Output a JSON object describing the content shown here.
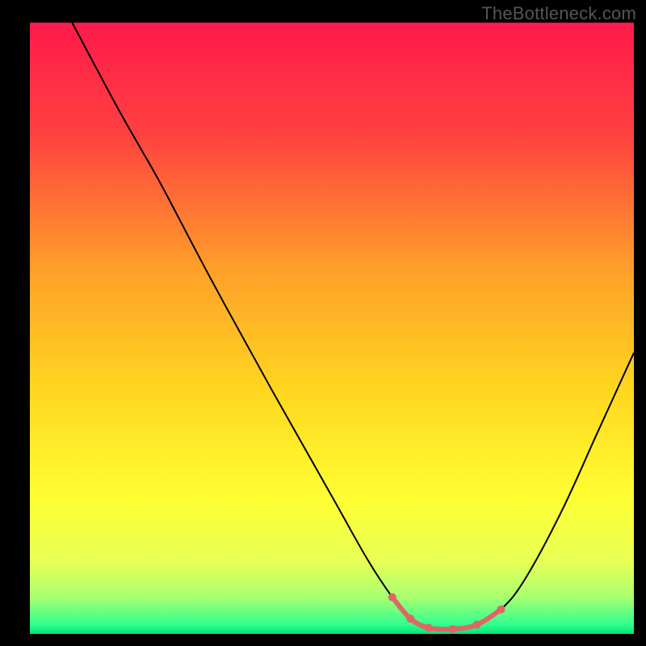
{
  "watermark": "TheBottleneck.com",
  "chart_data": {
    "type": "line",
    "title": "",
    "xlabel": "",
    "ylabel": "",
    "xlim": [
      0,
      100
    ],
    "ylim": [
      0,
      100
    ],
    "background_gradient": {
      "stops": [
        {
          "offset": 0.0,
          "color": "#ff1a4b"
        },
        {
          "offset": 0.18,
          "color": "#ff4040"
        },
        {
          "offset": 0.4,
          "color": "#ff9e2a"
        },
        {
          "offset": 0.6,
          "color": "#ffd61f"
        },
        {
          "offset": 0.78,
          "color": "#ffff33"
        },
        {
          "offset": 0.88,
          "color": "#e8ff55"
        },
        {
          "offset": 0.94,
          "color": "#a8ff70"
        },
        {
          "offset": 0.985,
          "color": "#2fff8f"
        },
        {
          "offset": 1.0,
          "color": "#00e676"
        }
      ]
    },
    "frame_color": "#000000",
    "curve": {
      "color": "#000000",
      "width": 2,
      "points": [
        {
          "x": 7.0,
          "y": 100.0
        },
        {
          "x": 14.0,
          "y": 87.0
        },
        {
          "x": 18.0,
          "y": 80.0
        },
        {
          "x": 22.0,
          "y": 73.0
        },
        {
          "x": 30.0,
          "y": 58.0
        },
        {
          "x": 40.0,
          "y": 40.0
        },
        {
          "x": 50.0,
          "y": 22.5
        },
        {
          "x": 56.0,
          "y": 12.0
        },
        {
          "x": 60.0,
          "y": 6.0
        },
        {
          "x": 63.0,
          "y": 2.5
        },
        {
          "x": 66.0,
          "y": 1.0
        },
        {
          "x": 70.0,
          "y": 0.8
        },
        {
          "x": 74.0,
          "y": 1.5
        },
        {
          "x": 78.0,
          "y": 4.0
        },
        {
          "x": 82.0,
          "y": 9.0
        },
        {
          "x": 88.0,
          "y": 20.0
        },
        {
          "x": 94.0,
          "y": 33.0
        },
        {
          "x": 100.0,
          "y": 46.0
        }
      ]
    },
    "optimal_band": {
      "color": "#e06666",
      "points": [
        {
          "x": 60.0,
          "y": 6.0
        },
        {
          "x": 63.0,
          "y": 2.5
        },
        {
          "x": 66.0,
          "y": 1.0
        },
        {
          "x": 70.0,
          "y": 0.8
        },
        {
          "x": 74.0,
          "y": 1.5
        },
        {
          "x": 78.0,
          "y": 4.0
        }
      ],
      "dot_radius": 5
    }
  }
}
